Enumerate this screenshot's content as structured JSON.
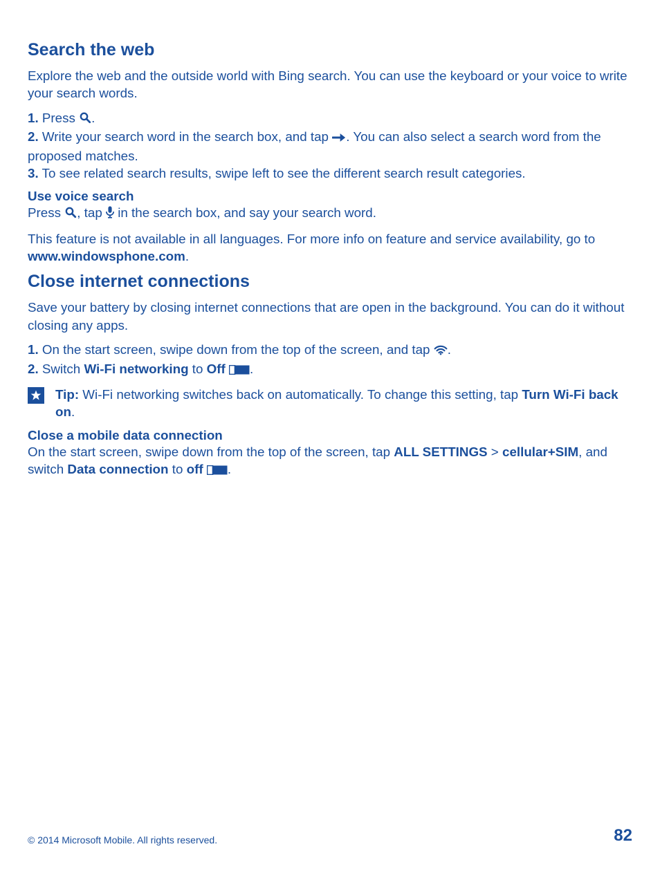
{
  "search": {
    "heading": "Search the web",
    "intro": "Explore the web and the outside world with Bing search. You can use the keyboard or your voice to write your search words.",
    "step1_num": "1.",
    "step1_a": " Press ",
    "step1_b": ".",
    "step2_num": "2.",
    "step2_a": " Write your search word in the search box, and tap ",
    "step2_b": ". You can also select a search word from the proposed matches.",
    "step3_num": "3.",
    "step3_a": " To see related search results, swipe left to see the different search result categories.",
    "voice_heading": "Use voice search",
    "voice_a": "Press ",
    "voice_b": ", tap ",
    "voice_c": " in the search box, and say your search word.",
    "avail_a": "This feature is not available in all languages. For more info on feature and service availability, go to ",
    "avail_link": "www.windowsphone.com",
    "avail_b": "."
  },
  "close": {
    "heading": "Close internet connections",
    "intro": "Save your battery by closing internet connections that are open in the background. You can do it without closing any apps.",
    "step1_num": "1.",
    "step1_a": " On the start screen, swipe down from the top of the screen, and tap ",
    "step1_b": ".",
    "step2_num": "2.",
    "step2_a": " Switch ",
    "step2_b": "Wi-Fi networking",
    "step2_c": " to ",
    "step2_d": "Off",
    "step2_e": " ",
    "step2_f": ".",
    "tip_label": "Tip:",
    "tip_a": " Wi-Fi networking switches back on automatically. To change this setting, tap ",
    "tip_b": "Turn Wi-Fi back on",
    "tip_c": ".",
    "mobile_heading": "Close a mobile data connection",
    "mobile_a": "On the start screen, swipe down from the top of the screen, tap ",
    "mobile_b": "ALL SETTINGS",
    "mobile_gt": " > ",
    "mobile_c": "cellular+SIM",
    "mobile_d": ", and switch ",
    "mobile_e": "Data connection",
    "mobile_f": " to ",
    "mobile_g": "off",
    "mobile_h": " ",
    "mobile_i": "."
  },
  "footer": {
    "copyright": "© 2014 Microsoft Mobile. All rights reserved.",
    "page": "82"
  }
}
